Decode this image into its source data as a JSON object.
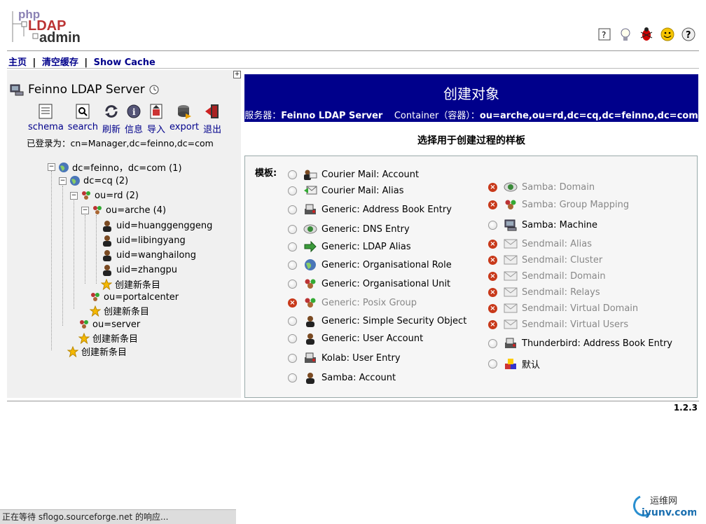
{
  "logo": {
    "line1": "php",
    "line2": "LDAP",
    "line3": "admin"
  },
  "header_icons": [
    "help-icon",
    "lightbulb-icon",
    "bug-icon",
    "smiley-icon",
    "question-icon"
  ],
  "topnav": {
    "home": "主页",
    "clear_cache": "清空缓存",
    "show_cache": "Show Cache",
    "separator": "|"
  },
  "expand_symbol": "+",
  "server": {
    "name": "Feinno LDAP Server"
  },
  "toolbar": [
    {
      "label": "schema",
      "icon": "schema-icon"
    },
    {
      "label": "search",
      "icon": "search-icon"
    },
    {
      "label": "刷新",
      "icon": "refresh-icon"
    },
    {
      "label": "信息",
      "icon": "info-icon"
    },
    {
      "label": "导入",
      "icon": "import-icon"
    },
    {
      "label": "export",
      "icon": "export-icon"
    },
    {
      "label": "退出",
      "icon": "logout-icon"
    }
  ],
  "logged_in": "已登录为：cn=Manager,dc=feinno,dc=com",
  "tree": {
    "root": "dc=feinno，dc=com (1)",
    "cq": "dc=cq (2)",
    "rd": "ou=rd (2)",
    "arche": "ou=arche (4)",
    "users": [
      "uid=huanggenggeng",
      "uid=libingyang",
      "uid=wanghailong",
      "uid=zhangpu"
    ],
    "create_new": "创建新条目",
    "portalcenter": "ou=portalcenter",
    "server": "ou=server",
    "toggle_symbol": "−"
  },
  "right": {
    "title": "创建对象",
    "server_label": "服务器：",
    "server_value": "Feinno LDAP Server",
    "container_label": "Container（容器）：",
    "container_value": "ou=arche,ou=rd,dc=cq,dc=feinno,dc=com",
    "choose": "选择用于创建过程的样板",
    "template_label": "模板:"
  },
  "templates_left": [
    {
      "label": "Courier Mail: Account",
      "enabled": true,
      "icon": "user-mail-icon"
    },
    {
      "label": "Courier Mail: Alias",
      "enabled": true,
      "icon": "mail-alias-icon"
    },
    {
      "label": "Generic: Address Book Entry",
      "enabled": true,
      "icon": "addressbook-icon"
    },
    {
      "label": "Generic: DNS Entry",
      "enabled": true,
      "icon": "dns-icon"
    },
    {
      "label": "Generic: LDAP Alias",
      "enabled": true,
      "icon": "arrow-icon"
    },
    {
      "label": "Generic: Organisational Role",
      "enabled": true,
      "icon": "globe-icon"
    },
    {
      "label": "Generic: Organisational Unit",
      "enabled": true,
      "icon": "ou-icon"
    },
    {
      "label": "Generic: Posix Group",
      "enabled": false,
      "icon": "group-icon"
    },
    {
      "label": "Generic: Simple Security Object",
      "enabled": true,
      "icon": "user-icon"
    },
    {
      "label": "Generic: User Account",
      "enabled": true,
      "icon": "user-icon"
    },
    {
      "label": "Kolab: User Entry",
      "enabled": true,
      "icon": "addressbook-icon"
    },
    {
      "label": "Samba: Account",
      "enabled": true,
      "icon": "user-icon"
    }
  ],
  "templates_right": [
    {
      "label": "Samba: Domain",
      "enabled": false,
      "icon": "dns-icon"
    },
    {
      "label": "Samba: Group Mapping",
      "enabled": false,
      "icon": "group-icon"
    },
    {
      "label": "Samba: Machine",
      "enabled": true,
      "icon": "computer-icon"
    },
    {
      "label": "Sendmail: Alias",
      "enabled": false,
      "icon": "mail-icon"
    },
    {
      "label": "Sendmail: Cluster",
      "enabled": false,
      "icon": "mail-icon"
    },
    {
      "label": "Sendmail: Domain",
      "enabled": false,
      "icon": "mail-icon"
    },
    {
      "label": "Sendmail: Relays",
      "enabled": false,
      "icon": "mail-icon"
    },
    {
      "label": "Sendmail: Virtual Domain",
      "enabled": false,
      "icon": "mail-icon"
    },
    {
      "label": "Sendmail: Virtual Users",
      "enabled": false,
      "icon": "mail-icon"
    },
    {
      "label": "Thunderbird: Address Book Entry",
      "enabled": true,
      "icon": "addressbook-icon"
    },
    {
      "label": "默认",
      "enabled": true,
      "icon": "default-icon"
    }
  ],
  "version": "1.2.3",
  "status": "正在等待 sflogo.sourceforge.net 的响应...",
  "watermark": {
    "top": "运维网",
    "bottom": "iyunv.com"
  },
  "colors": {
    "title_bg": "#00008b",
    "link": "#00008b",
    "disabled_x": "#c8391a"
  }
}
